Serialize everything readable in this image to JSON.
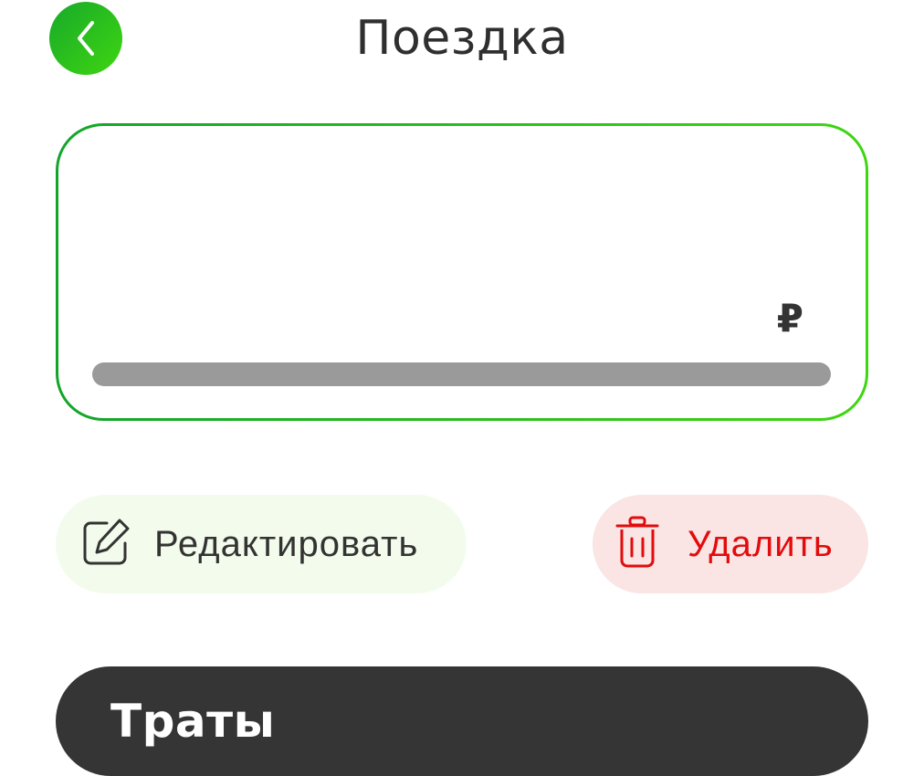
{
  "header": {
    "title": "Поездка",
    "back_icon": "chevron-left-icon"
  },
  "trip_card": {
    "currency": "₽",
    "progress": 1.0
  },
  "actions": {
    "edit_label": "Редактировать",
    "edit_icon": "edit-icon",
    "delete_label": "Удалить",
    "delete_icon": "trash-icon"
  },
  "expenses": {
    "title": "Траты"
  },
  "colors": {
    "accent_start": "#12a52a",
    "accent_end": "#3ed611",
    "danger": "#e30b0b",
    "edit_bg": "#f3fcec",
    "delete_bg": "#fae4e4",
    "dark": "#353535",
    "progress": "#9a9a9a"
  }
}
